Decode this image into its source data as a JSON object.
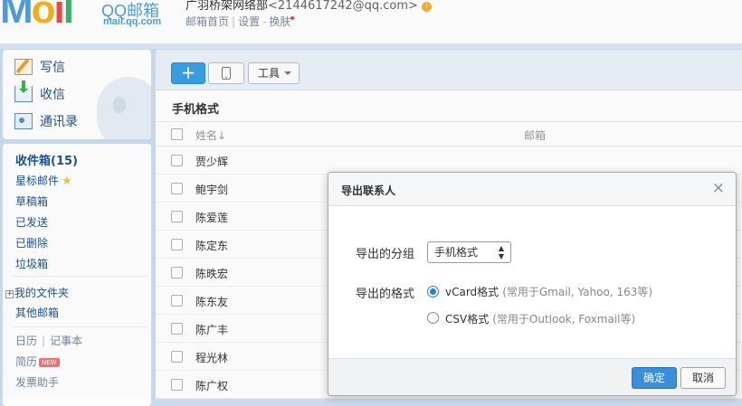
{
  "header": {
    "logo": {
      "mail_m": "M",
      "mail_o": "o",
      "mail_i": "i",
      "mail_l": "l",
      "qq": "QQ邮箱",
      "domain": "mail.qq.com"
    },
    "account_name": "广羽桥架网络部",
    "account_email": "<2144617242@qq.com>",
    "links": [
      "邮箱首页",
      "设置",
      "换肤"
    ]
  },
  "sidebar": {
    "actions": [
      {
        "label": "写信",
        "icon": "compose-icon"
      },
      {
        "label": "收信",
        "icon": "inbox-download-icon"
      },
      {
        "label": "通讯录",
        "icon": "contacts-icon"
      }
    ],
    "folders": {
      "inbox": "收件箱(15)",
      "starred": "星标邮件",
      "drafts": "草稿箱",
      "sent": "已发送",
      "deleted": "已删除",
      "trash": "垃圾箱",
      "my_folders": "我的文件夹",
      "other_mailbox": "其他邮箱",
      "calendar": "日历",
      "notepad": "记事本",
      "resume": "简历",
      "new_badge": "NEW",
      "invoice": "发票助手"
    }
  },
  "toolbar": {
    "add_label": "+",
    "tools_label": "工具"
  },
  "contacts": {
    "group_title": "手机格式",
    "columns": {
      "name": "姓名↓",
      "email": "邮箱"
    },
    "rows": [
      "贾少辉",
      "鲍宇剑",
      "陈爱莲",
      "陈定东",
      "陈昳宏",
      "陈东友",
      "陈广丰",
      "程光林",
      "陈广权"
    ]
  },
  "dialog": {
    "title": "导出联系人",
    "close": "×",
    "group_label": "导出的分组",
    "group_value": "手机格式",
    "format_label": "导出的格式",
    "formats": [
      {
        "label": "vCard格式",
        "hint": "(常用于Gmail, Yahoo, 163等)",
        "selected": true
      },
      {
        "label": "CSV格式",
        "hint": "(常用于Outlook, Foxmail等)",
        "selected": false
      }
    ],
    "ok": "确定",
    "cancel": "取消"
  },
  "colors": {
    "accent": "#3a8fd8",
    "link": "#1e5494",
    "page_bg": "#c9dced"
  }
}
